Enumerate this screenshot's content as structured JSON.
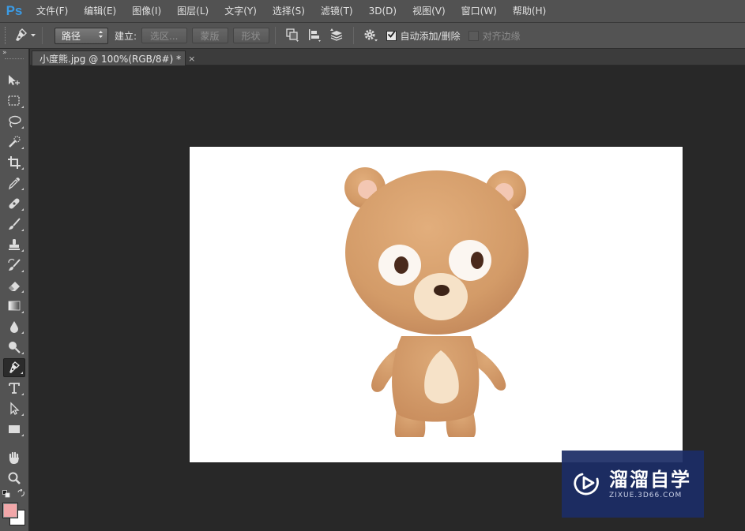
{
  "app": {
    "logo_text": "Ps"
  },
  "menu": {
    "items": [
      {
        "label": "文件(F)"
      },
      {
        "label": "编辑(E)"
      },
      {
        "label": "图像(I)"
      },
      {
        "label": "图层(L)"
      },
      {
        "label": "文字(Y)"
      },
      {
        "label": "选择(S)"
      },
      {
        "label": "滤镜(T)"
      },
      {
        "label": "3D(D)"
      },
      {
        "label": "视图(V)"
      },
      {
        "label": "窗口(W)"
      },
      {
        "label": "帮助(H)"
      }
    ]
  },
  "options": {
    "tool_icon": "pen-icon",
    "mode_value": "路径",
    "make_label": "建立:",
    "selection_button": "选区...",
    "mask_button": "蒙版",
    "shape_button": "形状",
    "path_ops_icon": "path-operations-icon",
    "path_align_icon": "path-alignment-icon",
    "path_arrange_icon": "path-arrangement-icon",
    "settings_icon": "gear-icon",
    "auto_add_delete_label": "自动添加/删除",
    "auto_add_delete_checked": true,
    "align_edges_label": "对齐边缘",
    "align_edges_checked": false
  },
  "toolbar": {
    "collapse_glyph": "»",
    "tools": [
      {
        "name": "move-tool",
        "icon": "move-icon"
      },
      {
        "name": "marquee-tool",
        "icon": "rectangular-marquee-icon"
      },
      {
        "name": "lasso-tool",
        "icon": "lasso-icon"
      },
      {
        "name": "quick-selection-tool",
        "icon": "quick-selection-icon"
      },
      {
        "name": "crop-tool",
        "icon": "crop-icon"
      },
      {
        "name": "eyedropper-tool",
        "icon": "eyedropper-icon"
      },
      {
        "name": "healing-brush-tool",
        "icon": "bandage-icon"
      },
      {
        "name": "brush-tool",
        "icon": "brush-icon"
      },
      {
        "name": "clone-stamp-tool",
        "icon": "stamp-icon"
      },
      {
        "name": "history-brush-tool",
        "icon": "history-brush-icon"
      },
      {
        "name": "eraser-tool",
        "icon": "eraser-icon"
      },
      {
        "name": "gradient-tool",
        "icon": "gradient-icon"
      },
      {
        "name": "blur-tool",
        "icon": "drop-icon"
      },
      {
        "name": "dodge-tool",
        "icon": "dodge-icon"
      },
      {
        "name": "pen-tool",
        "icon": "pen-icon",
        "active": true
      },
      {
        "name": "type-tool",
        "icon": "type-icon"
      },
      {
        "name": "path-selection-tool",
        "icon": "arrow-icon"
      },
      {
        "name": "rectangle-tool",
        "icon": "rectangle-icon"
      },
      {
        "name": "hand-tool",
        "icon": "hand-icon"
      },
      {
        "name": "zoom-tool",
        "icon": "zoom-icon"
      }
    ],
    "foreground_color": "#f2a7a9",
    "background_color": "#ffffff"
  },
  "document": {
    "tab_title": "小度熊.jpg @ 100%(RGB/8#) *",
    "tab_close": "×",
    "image_subject": "teddy-bear-image"
  },
  "watermark": {
    "title": "溜溜自学",
    "url": "ZIXUE.3D66.COM",
    "bg_color": "#1c2d66"
  },
  "colors": {
    "menubar": "#525252",
    "panel": "#535353",
    "workspace": "#282828",
    "ps_blue": "#3b9be5"
  }
}
